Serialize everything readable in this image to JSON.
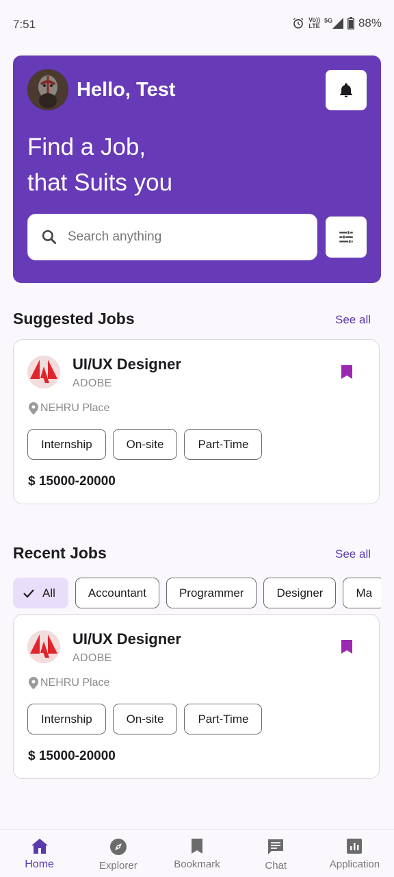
{
  "status_bar": {
    "time": "7:51",
    "network_top": "Vo))",
    "network_bottom": "LTE",
    "signal_label": "5G",
    "battery": "88%"
  },
  "header": {
    "greeting": "Hello, Test",
    "tagline_line1": "Find a Job,",
    "tagline_line2": "that Suits you",
    "search_placeholder": "Search anything",
    "accent_color": "#673AB7"
  },
  "suggested": {
    "title": "Suggested Jobs",
    "see_all": "See all",
    "job": {
      "title": "UI/UX Designer",
      "company": "ADOBE",
      "location": "NEHRU Place",
      "tags": [
        "Internship",
        "On-site",
        "Part-Time"
      ],
      "salary": "$ 15000-20000"
    }
  },
  "recent": {
    "title": "Recent Jobs",
    "see_all": "See all",
    "filters": [
      "All",
      "Accountant",
      "Programmer",
      "Designer",
      "Ma"
    ],
    "selected_filter": "All",
    "job": {
      "title": "UI/UX Designer",
      "company": "ADOBE",
      "location": "NEHRU Place",
      "tags": [
        "Internship",
        "On-site",
        "Part-Time"
      ],
      "salary": "$ 15000-20000"
    }
  },
  "bottom_nav": {
    "items": [
      {
        "label": "Home",
        "icon": "home-icon",
        "active": true
      },
      {
        "label": "Explorer",
        "icon": "compass-icon",
        "active": false
      },
      {
        "label": "Bookmark",
        "icon": "bookmark-icon",
        "active": false
      },
      {
        "label": "Chat",
        "icon": "chat-icon",
        "active": false
      },
      {
        "label": "Application",
        "icon": "bar-chart-icon",
        "active": false
      }
    ]
  }
}
